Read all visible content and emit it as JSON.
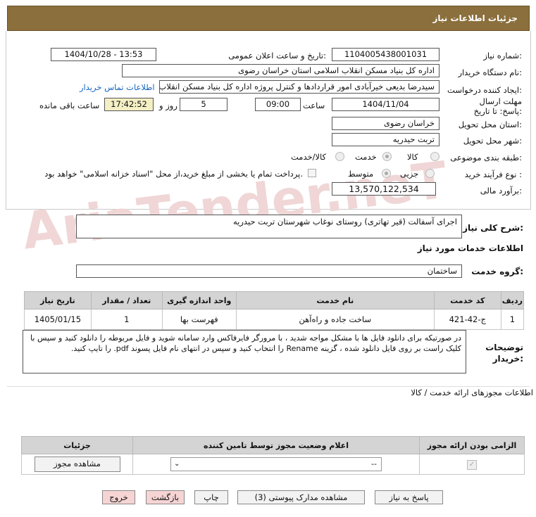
{
  "header": {
    "title": "جزئیات اطلاعات نیاز"
  },
  "form": {
    "need_number_label": "شماره نیاز:",
    "need_number": "1104005438001031",
    "announce_label": "تاریخ و ساعت اعلان عمومی:",
    "announce_value": "1404/10/28 - 13:53",
    "buyer_org_label": "نام دستگاه خریدار:",
    "buyer_org": "اداره کل بنیاد مسکن انقلاب اسلامی استان خراسان رضوی",
    "requester_label": "ایجاد کننده درخواست:",
    "requester": "سیدرضا بدیعی خیرآبادی امور قراردادها و کنترل پروژه اداره کل بنیاد مسکن انقلاب",
    "contact_link": "اطلاعات تماس خریدار",
    "deadline_label": "مهلت ارسال پاسخ: تا تاریخ:",
    "deadline_date": "1404/11/04",
    "time_label": "ساعت",
    "deadline_time": "09:00",
    "days_value": "5",
    "days_label": "روز و",
    "remaining_time": "17:42:52",
    "remaining_label": "ساعت باقی مانده",
    "province_label": "استان محل تحویل:",
    "province": "خراسان رضوی",
    "city_label": "شهر محل تحویل:",
    "city": "تربت حیدریه",
    "category_label": "طبقه بندی موضوعی:",
    "cat_goods": "کالا",
    "cat_service": "خدمت",
    "cat_goods_service": "کالا/خدمت",
    "process_label": "نوع فرآیند خرید :",
    "proc_partial": "جزیی",
    "proc_medium": "متوسط",
    "treasury_text": "پرداخت تمام یا بخشی از مبلغ خرید،از محل \"اسناد خزانه اسلامی\" خواهد بود.",
    "budget_label": "برآورد مالی:",
    "budget": "13,570,122,534"
  },
  "summary": {
    "label": "شرح کلی نیاز:",
    "value": "اجرای آسفالت (قیر تهاتری) روستای نوغاب شهرستان تربت حیدریه"
  },
  "services": {
    "section_title": "اطلاعات خدمات مورد نیاز",
    "group_label": "گروه خدمت:",
    "group_value": "ساختمان",
    "headers": [
      "ردیف",
      "کد خدمت",
      "نام خدمت",
      "واحد اندازه گیری",
      "تعداد / مقدار",
      "تاریخ نیاز"
    ],
    "rows": [
      [
        "1",
        "ج-42-421",
        "ساخت جاده و راه‌آهن",
        "فهرست بها",
        "1",
        "1405/01/15"
      ]
    ]
  },
  "notes": {
    "label": "توضیحات خریدار:",
    "value": "در صورتیکه برای دانلود فایل ها با مشکل مواجه شدید ، با مرورگر فایرفاکس وارد سامانه شوید و فایل مربوطه را دانلود کنید و سپس با کلیک راست بر روی فایل دانلود شده ، گزینه Rename را انتخاب کنید و سپس در انتهای نام فایل پسوند pdf. را تایپ کنید."
  },
  "permits": {
    "title": "اطلاعات مجوزهای ارائه خدمت / کالا",
    "headers": [
      "الزامی بودن ارائه مجوز",
      "اعلام وضعیت مجوز توسط تامین کننده",
      "جزئیات"
    ],
    "select_value": "--",
    "view_button": "مشاهده مجوز"
  },
  "buttons": {
    "reply": "پاسخ به نیاز",
    "attachments": "مشاهده مدارک پیوستی (3)",
    "print": "چاپ",
    "back": "بازگشت",
    "exit": "خروج"
  }
}
